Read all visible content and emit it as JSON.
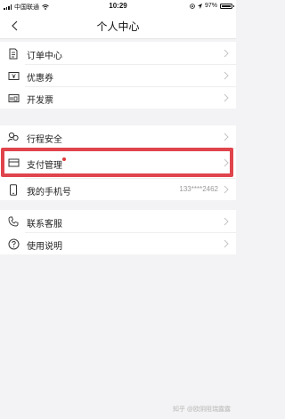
{
  "status_bar": {
    "carrier": "中国联通",
    "time": "10:29",
    "battery": "97%"
  },
  "nav": {
    "title": "个人中心"
  },
  "groups": [
    {
      "items": [
        {
          "label": "订单中心",
          "icon": "order-document-icon"
        },
        {
          "label": "优惠券",
          "icon": "coupon-ticket-icon"
        },
        {
          "label": "开发票",
          "icon": "invoice-icon"
        }
      ]
    },
    {
      "items": [
        {
          "label": "行程安全",
          "icon": "trip-safety-people-icon"
        },
        {
          "label": "支付管理",
          "icon": "payment-card-icon",
          "badge": "red-dot",
          "highlighted": true
        },
        {
          "label": "我的手机号",
          "icon": "mobile-phone-icon",
          "value": "133****2462"
        }
      ]
    },
    {
      "items": [
        {
          "label": "联系客服",
          "icon": "telephone-icon"
        },
        {
          "label": "使用说明",
          "icon": "question-circle-icon"
        }
      ]
    }
  ],
  "watermark": "知乎 @欧阴阻瑞露露",
  "colors": {
    "highlight": "#e0444c",
    "badge": "#e03a3a",
    "background": "#f3f3f5"
  }
}
